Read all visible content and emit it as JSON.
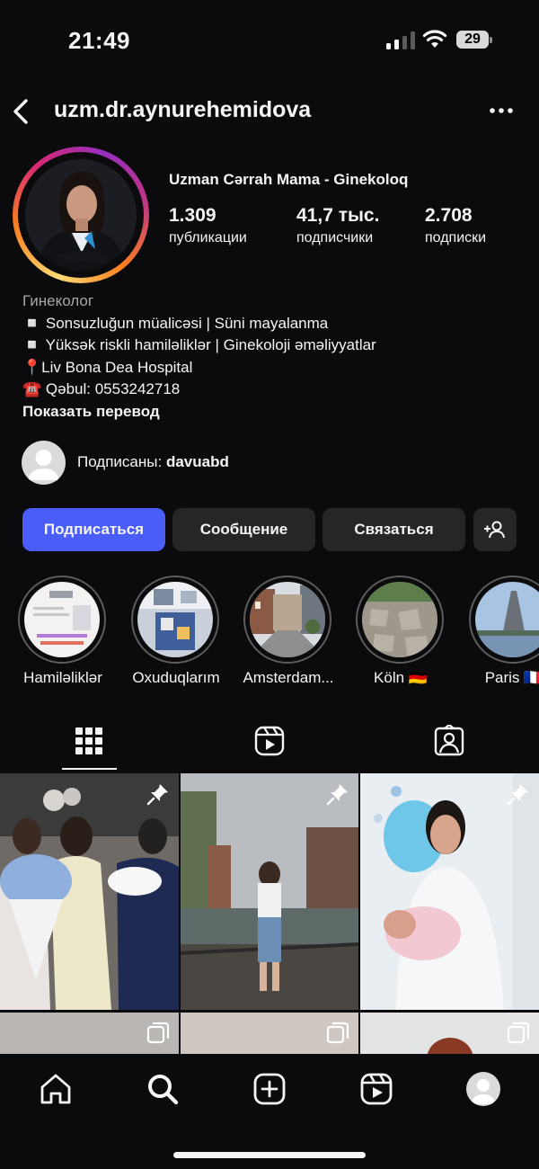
{
  "status_bar": {
    "time": "21:49",
    "battery": "29"
  },
  "header": {
    "username": "uzm.dr.aynurehemidova"
  },
  "profile": {
    "display_name": "Uzman Cərrah Mama - Ginekoloq",
    "stats": [
      {
        "value": "1.309",
        "label": "публикации"
      },
      {
        "value": "41,7 тыс.",
        "label": "подписчики"
      },
      {
        "value": "2.708",
        "label": "подписки"
      }
    ],
    "category": "Гинеколог",
    "bio_lines": [
      "◽️ Sonsuzluğun müalicəsi | Süni mayalanma",
      "◽️ Yüksək riskli hamiləliklər | Ginekoloji əməliyyatlar",
      "📍Liv Bona Dea Hospital",
      "☎️ Qəbul: 0553242718"
    ],
    "translate_label": "Показать перевод"
  },
  "followed_by": {
    "prefix": "Подписаны: ",
    "user": "davuabd"
  },
  "actions": {
    "follow": "Подписаться",
    "message": "Сообщение",
    "contact": "Связаться"
  },
  "highlights": [
    {
      "name": "Hamiləliklər"
    },
    {
      "name": "Oxuduqlarım"
    },
    {
      "name": "Amsterdam..."
    },
    {
      "name": "Köln 🇩🇪"
    },
    {
      "name": "Paris 🇫🇷"
    }
  ],
  "tabs": [
    {
      "icon": "grid-icon",
      "active": true
    },
    {
      "icon": "reels-icon",
      "active": false
    },
    {
      "icon": "tagged-icon",
      "active": false
    }
  ],
  "bottom_nav": [
    {
      "icon": "home-icon"
    },
    {
      "icon": "search-icon",
      "active": true
    },
    {
      "icon": "create-icon"
    },
    {
      "icon": "reels-icon"
    },
    {
      "icon": "profile-icon"
    }
  ],
  "colors": {
    "accent": "#4a5df9",
    "background": "#0b0b0d",
    "button": "#262628"
  }
}
